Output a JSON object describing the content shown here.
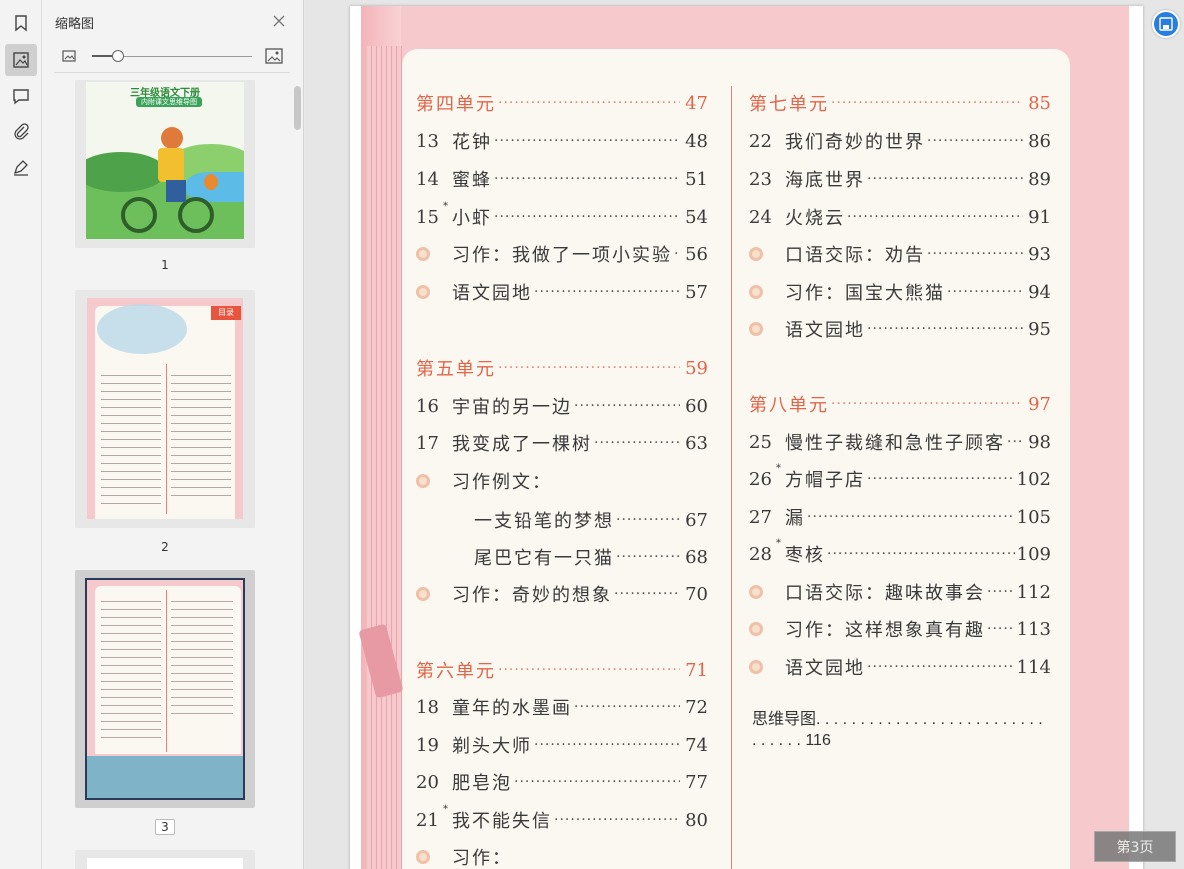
{
  "panel": {
    "title": "缩略图",
    "thumbnails": [
      {
        "number": "1",
        "cover_line1": "三年级语文下册",
        "cover_line2": "内附课文思维导图"
      },
      {
        "number": "2",
        "tag": "目录"
      },
      {
        "number": "3"
      }
    ]
  },
  "rail": {
    "icons": [
      "bookmark-icon",
      "thumbnail-icon",
      "comment-icon",
      "attachment-icon",
      "signature-icon"
    ]
  },
  "toc": {
    "left": [
      {
        "kind": "unit",
        "title": "第四单元",
        "page": "47"
      },
      {
        "kind": "lesson",
        "num": "13",
        "star": false,
        "title": "花钟",
        "page": "48"
      },
      {
        "kind": "lesson",
        "num": "14",
        "star": false,
        "title": "蜜蜂",
        "page": "51"
      },
      {
        "kind": "lesson",
        "num": "15",
        "star": true,
        "title": "小虾",
        "page": "54"
      },
      {
        "kind": "bullet",
        "title": "习作：我做了一项小实验",
        "page": "56"
      },
      {
        "kind": "bullet",
        "title": "语文园地",
        "page": "57"
      },
      {
        "kind": "unit",
        "title": "第五单元",
        "page": "59"
      },
      {
        "kind": "lesson",
        "num": "16",
        "star": false,
        "title": "宇宙的另一边",
        "page": "60"
      },
      {
        "kind": "lesson",
        "num": "17",
        "star": false,
        "title": "我变成了一棵树",
        "page": "63"
      },
      {
        "kind": "bullet",
        "title": "习作例文：",
        "page": ""
      },
      {
        "kind": "sub",
        "title": "一支铅笔的梦想",
        "page": "67"
      },
      {
        "kind": "sub",
        "title": "尾巴它有一只猫",
        "page": "68"
      },
      {
        "kind": "bullet",
        "title": "习作：奇妙的想象",
        "page": "70"
      },
      {
        "kind": "unit",
        "title": "第六单元",
        "page": "71"
      },
      {
        "kind": "lesson",
        "num": "18",
        "star": false,
        "title": "童年的水墨画",
        "page": "72"
      },
      {
        "kind": "lesson",
        "num": "19",
        "star": false,
        "title": "剃头大师",
        "page": "74"
      },
      {
        "kind": "lesson",
        "num": "20",
        "star": false,
        "title": "肥皂泡",
        "page": "77"
      },
      {
        "kind": "lesson",
        "num": "21",
        "star": true,
        "title": "我不能失信",
        "page": "80"
      },
      {
        "kind": "bullet",
        "title": "习作：",
        "page": ""
      }
    ],
    "right": [
      {
        "kind": "unit",
        "title": "第七单元",
        "page": "85"
      },
      {
        "kind": "lesson",
        "num": "22",
        "star": false,
        "title": "我们奇妙的世界",
        "page": "86"
      },
      {
        "kind": "lesson",
        "num": "23",
        "star": false,
        "title": "海底世界",
        "page": "89"
      },
      {
        "kind": "lesson",
        "num": "24",
        "star": false,
        "title": "火烧云",
        "page": "91"
      },
      {
        "kind": "bullet",
        "title": "口语交际：劝告",
        "page": "93"
      },
      {
        "kind": "bullet",
        "title": "习作：国宝大熊猫",
        "page": "94"
      },
      {
        "kind": "bullet",
        "title": "语文园地",
        "page": "95"
      },
      {
        "kind": "unit",
        "title": "第八单元",
        "page": "97"
      },
      {
        "kind": "lesson",
        "num": "25",
        "star": false,
        "title": "慢性子裁缝和急性子顾客",
        "page": "98"
      },
      {
        "kind": "lesson",
        "num": "26",
        "star": true,
        "title": "方帽子店",
        "page": "102"
      },
      {
        "kind": "lesson",
        "num": "27",
        "star": false,
        "title": "漏",
        "page": "105"
      },
      {
        "kind": "lesson",
        "num": "28",
        "star": true,
        "title": "枣核",
        "page": "109"
      },
      {
        "kind": "bullet",
        "title": "口语交际：趣味故事会",
        "page": "112"
      },
      {
        "kind": "bullet",
        "title": "习作：这样想象真有趣",
        "page": "113"
      },
      {
        "kind": "bullet",
        "title": "语文园地",
        "page": "114"
      }
    ],
    "mindmap_line1": "思维导图. . . . . . . . . . . . . . . . . . . . . . . . . .",
    "mindmap_line2": ". . . . . . 116"
  },
  "page_indicator": "第3页",
  "colors": {
    "accent": "#e0664a",
    "page_bg": "#f6c9cd",
    "paper": "#fbf7f1",
    "float_button": "#2a7de0"
  }
}
